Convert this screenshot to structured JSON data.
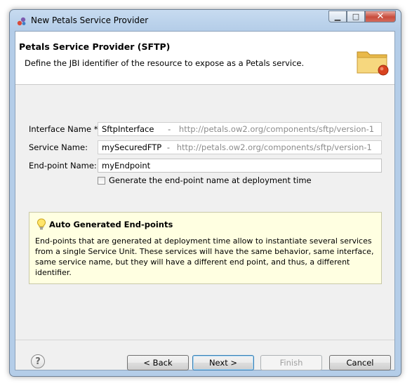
{
  "window": {
    "title": "New Petals Service Provider",
    "close_glyph": "✕",
    "minimize_glyph": "▁",
    "maximize_glyph": "□"
  },
  "banner": {
    "title": "Petals Service Provider (SFTP)",
    "description": "Define the JBI identifier of the resource to expose as a Petals service.",
    "icon": "folder-icon"
  },
  "form": {
    "interface": {
      "label": "Interface Name *:",
      "value": "SftpInterface",
      "separator": "-",
      "namespace": "http://petals.ow2.org/components/sftp/version-1"
    },
    "service": {
      "label": "Service Name:",
      "value": "mySecuredFTP",
      "separator": "-",
      "namespace": "http://petals.ow2.org/components/sftp/version-1"
    },
    "endpoint": {
      "label": "End-point Name:",
      "value": "myEndpoint"
    },
    "generate_checkbox": {
      "label": "Generate the end-point name at deployment time",
      "checked": false
    }
  },
  "info": {
    "title": "Auto Generated End-points",
    "body": "End-points that are generated at deployment time allow to instantiate several services from a single Service Unit. These services will have the same behavior, same interface, same service name, but they will have a different end point, and thus, a different identifier.",
    "icon": "lightbulb-icon"
  },
  "buttons": {
    "help": "?",
    "back": "< Back",
    "next": "Next >",
    "finish": "Finish",
    "cancel": "Cancel"
  }
}
